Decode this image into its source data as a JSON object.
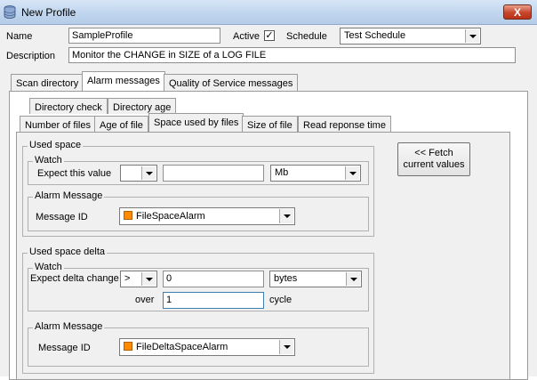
{
  "window": {
    "title": "New Profile",
    "close_label": "X"
  },
  "header": {
    "name_label": "Name",
    "name_value": "SampleProfile",
    "active_label": "Active",
    "active_checked": "✓",
    "schedule_label": "Schedule",
    "schedule_value": "Test Schedule",
    "description_label": "Description",
    "description_value": "Monitor the CHANGE in SIZE of a LOG FILE"
  },
  "main_tabs": [
    {
      "label": "Scan directory"
    },
    {
      "label": "Alarm messages",
      "active": true
    },
    {
      "label": "Quality of Service messages"
    }
  ],
  "sub_tabs_row1": [
    {
      "label": "Directory check"
    },
    {
      "label": "Directory age"
    }
  ],
  "sub_tabs_row2": [
    {
      "label": "Number of files"
    },
    {
      "label": "Age of file"
    },
    {
      "label": "Space used by files",
      "active": true
    },
    {
      "label": "Size of file"
    },
    {
      "label": "Read reponse time"
    }
  ],
  "used_space": {
    "title": "Used space",
    "watch_title": "Watch",
    "expect_label": "Expect this value",
    "operator_value": "",
    "value": "",
    "unit_value": "Mb",
    "alarm_title": "Alarm Message",
    "message_id_label": "Message ID",
    "message_id_value": "FileSpaceAlarm"
  },
  "used_space_delta": {
    "title": "Used space delta",
    "watch_title": "Watch",
    "expect_label": "Expect delta change",
    "operator_value": ">",
    "value": "0",
    "unit_value": "bytes",
    "over_label": "over",
    "over_value": "1",
    "cycle_label": "cycle",
    "alarm_title": "Alarm Message",
    "message_id_label": "Message ID",
    "message_id_value": "FileDeltaSpaceAlarm"
  },
  "fetch_button": {
    "line1": "<< Fetch",
    "line2": "current values"
  },
  "colors": {
    "message_icon": "#ff8c00",
    "title_bar": "#c2d7ef",
    "close_button": "#c7452b"
  },
  "icons": {
    "app": "database-icon",
    "message": "orange-square-icon"
  }
}
